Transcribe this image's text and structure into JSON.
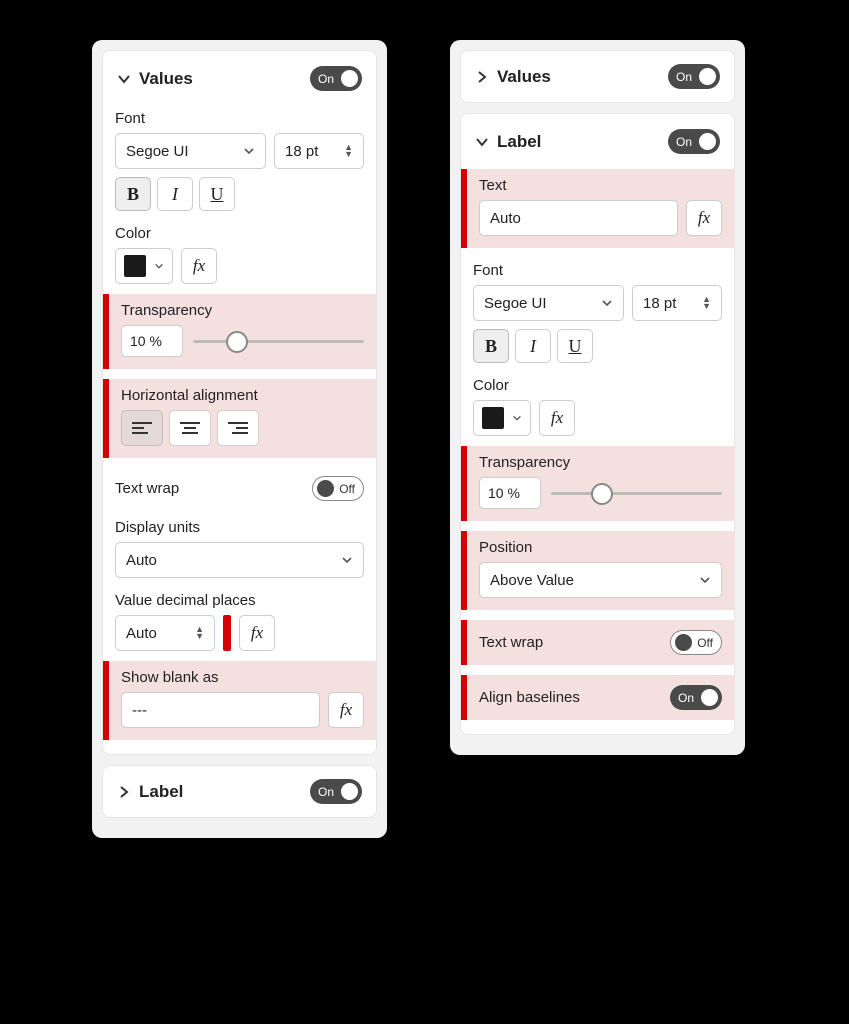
{
  "panel1": {
    "values": {
      "title": "Values",
      "toggle": "On",
      "font_label": "Font",
      "font_family": "Segoe UI",
      "font_size": "18 pt",
      "bold": "B",
      "italic": "I",
      "underline": "U",
      "color_label": "Color",
      "color_value": "#1A1A1A",
      "transparency_label": "Transparency",
      "transparency_value": "10 %",
      "transparency_pct": 26,
      "halign_label": "Horizontal alignment",
      "textwrap_label": "Text wrap",
      "textwrap_toggle": "Off",
      "display_units_label": "Display units",
      "display_units_value": "Auto",
      "decimal_label": "Value decimal places",
      "decimal_value": "Auto",
      "blank_label": "Show blank as",
      "blank_value": "---"
    },
    "label_section": {
      "title": "Label",
      "toggle": "On"
    }
  },
  "panel2": {
    "values_section": {
      "title": "Values",
      "toggle": "On"
    },
    "label": {
      "title": "Label",
      "toggle": "On",
      "text_label": "Text",
      "text_value": "Auto",
      "font_label": "Font",
      "font_family": "Segoe UI",
      "font_size": "18 pt",
      "bold": "B",
      "italic": "I",
      "underline": "U",
      "color_label": "Color",
      "color_value": "#1A1A1A",
      "transparency_label": "Transparency",
      "transparency_value": "10 %",
      "transparency_pct": 30,
      "position_label": "Position",
      "position_value": "Above Value",
      "textwrap_label": "Text wrap",
      "textwrap_toggle": "Off",
      "baselines_label": "Align baselines",
      "baselines_toggle": "On"
    }
  },
  "icons": {
    "fx": "fx"
  }
}
